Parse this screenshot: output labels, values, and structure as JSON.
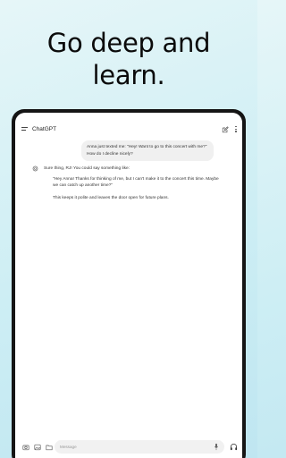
{
  "headline": {
    "line1": "Go deep and",
    "line2": "learn."
  },
  "app": {
    "title": "ChatGPT"
  },
  "conversation": {
    "user_message": "Anna just texted me: \"Hey! Want to go to this concert with me?\" How do I decline nicely?",
    "assistant_intro": "Sure thing, RJ! You could say something like:",
    "assistant_quote": "\"Hey Anna! Thanks for thinking of me, but I can't make it to the concert this time. Maybe we can catch up another time?\"",
    "assistant_outro": "This keeps it polite and leaves the door open for future plans."
  },
  "composer": {
    "placeholder": "Message"
  },
  "icons": [
    "menu-icon",
    "edit-icon",
    "more-icon",
    "gpt-icon",
    "camera-icon",
    "image-icon",
    "folder-icon",
    "mic-icon",
    "headphones-icon"
  ]
}
